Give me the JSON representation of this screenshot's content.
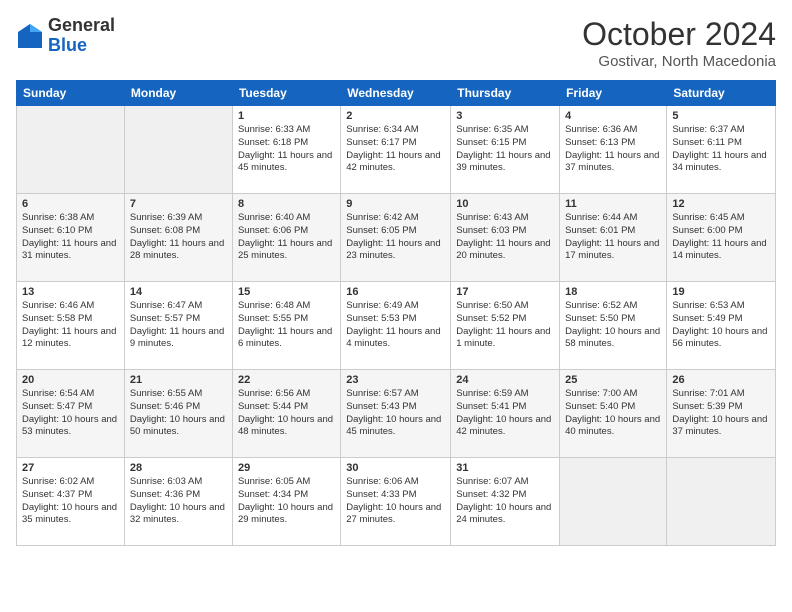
{
  "logo": {
    "general": "General",
    "blue": "Blue"
  },
  "header": {
    "month": "October 2024",
    "location": "Gostivar, North Macedonia"
  },
  "days_of_week": [
    "Sunday",
    "Monday",
    "Tuesday",
    "Wednesday",
    "Thursday",
    "Friday",
    "Saturday"
  ],
  "weeks": [
    [
      {
        "day": "",
        "sunrise": "",
        "sunset": "",
        "daylight": ""
      },
      {
        "day": "",
        "sunrise": "",
        "sunset": "",
        "daylight": ""
      },
      {
        "day": "1",
        "sunrise": "Sunrise: 6:33 AM",
        "sunset": "Sunset: 6:18 PM",
        "daylight": "Daylight: 11 hours and 45 minutes."
      },
      {
        "day": "2",
        "sunrise": "Sunrise: 6:34 AM",
        "sunset": "Sunset: 6:17 PM",
        "daylight": "Daylight: 11 hours and 42 minutes."
      },
      {
        "day": "3",
        "sunrise": "Sunrise: 6:35 AM",
        "sunset": "Sunset: 6:15 PM",
        "daylight": "Daylight: 11 hours and 39 minutes."
      },
      {
        "day": "4",
        "sunrise": "Sunrise: 6:36 AM",
        "sunset": "Sunset: 6:13 PM",
        "daylight": "Daylight: 11 hours and 37 minutes."
      },
      {
        "day": "5",
        "sunrise": "Sunrise: 6:37 AM",
        "sunset": "Sunset: 6:11 PM",
        "daylight": "Daylight: 11 hours and 34 minutes."
      }
    ],
    [
      {
        "day": "6",
        "sunrise": "Sunrise: 6:38 AM",
        "sunset": "Sunset: 6:10 PM",
        "daylight": "Daylight: 11 hours and 31 minutes."
      },
      {
        "day": "7",
        "sunrise": "Sunrise: 6:39 AM",
        "sunset": "Sunset: 6:08 PM",
        "daylight": "Daylight: 11 hours and 28 minutes."
      },
      {
        "day": "8",
        "sunrise": "Sunrise: 6:40 AM",
        "sunset": "Sunset: 6:06 PM",
        "daylight": "Daylight: 11 hours and 25 minutes."
      },
      {
        "day": "9",
        "sunrise": "Sunrise: 6:42 AM",
        "sunset": "Sunset: 6:05 PM",
        "daylight": "Daylight: 11 hours and 23 minutes."
      },
      {
        "day": "10",
        "sunrise": "Sunrise: 6:43 AM",
        "sunset": "Sunset: 6:03 PM",
        "daylight": "Daylight: 11 hours and 20 minutes."
      },
      {
        "day": "11",
        "sunrise": "Sunrise: 6:44 AM",
        "sunset": "Sunset: 6:01 PM",
        "daylight": "Daylight: 11 hours and 17 minutes."
      },
      {
        "day": "12",
        "sunrise": "Sunrise: 6:45 AM",
        "sunset": "Sunset: 6:00 PM",
        "daylight": "Daylight: 11 hours and 14 minutes."
      }
    ],
    [
      {
        "day": "13",
        "sunrise": "Sunrise: 6:46 AM",
        "sunset": "Sunset: 5:58 PM",
        "daylight": "Daylight: 11 hours and 12 minutes."
      },
      {
        "day": "14",
        "sunrise": "Sunrise: 6:47 AM",
        "sunset": "Sunset: 5:57 PM",
        "daylight": "Daylight: 11 hours and 9 minutes."
      },
      {
        "day": "15",
        "sunrise": "Sunrise: 6:48 AM",
        "sunset": "Sunset: 5:55 PM",
        "daylight": "Daylight: 11 hours and 6 minutes."
      },
      {
        "day": "16",
        "sunrise": "Sunrise: 6:49 AM",
        "sunset": "Sunset: 5:53 PM",
        "daylight": "Daylight: 11 hours and 4 minutes."
      },
      {
        "day": "17",
        "sunrise": "Sunrise: 6:50 AM",
        "sunset": "Sunset: 5:52 PM",
        "daylight": "Daylight: 11 hours and 1 minute."
      },
      {
        "day": "18",
        "sunrise": "Sunrise: 6:52 AM",
        "sunset": "Sunset: 5:50 PM",
        "daylight": "Daylight: 10 hours and 58 minutes."
      },
      {
        "day": "19",
        "sunrise": "Sunrise: 6:53 AM",
        "sunset": "Sunset: 5:49 PM",
        "daylight": "Daylight: 10 hours and 56 minutes."
      }
    ],
    [
      {
        "day": "20",
        "sunrise": "Sunrise: 6:54 AM",
        "sunset": "Sunset: 5:47 PM",
        "daylight": "Daylight: 10 hours and 53 minutes."
      },
      {
        "day": "21",
        "sunrise": "Sunrise: 6:55 AM",
        "sunset": "Sunset: 5:46 PM",
        "daylight": "Daylight: 10 hours and 50 minutes."
      },
      {
        "day": "22",
        "sunrise": "Sunrise: 6:56 AM",
        "sunset": "Sunset: 5:44 PM",
        "daylight": "Daylight: 10 hours and 48 minutes."
      },
      {
        "day": "23",
        "sunrise": "Sunrise: 6:57 AM",
        "sunset": "Sunset: 5:43 PM",
        "daylight": "Daylight: 10 hours and 45 minutes."
      },
      {
        "day": "24",
        "sunrise": "Sunrise: 6:59 AM",
        "sunset": "Sunset: 5:41 PM",
        "daylight": "Daylight: 10 hours and 42 minutes."
      },
      {
        "day": "25",
        "sunrise": "Sunrise: 7:00 AM",
        "sunset": "Sunset: 5:40 PM",
        "daylight": "Daylight: 10 hours and 40 minutes."
      },
      {
        "day": "26",
        "sunrise": "Sunrise: 7:01 AM",
        "sunset": "Sunset: 5:39 PM",
        "daylight": "Daylight: 10 hours and 37 minutes."
      }
    ],
    [
      {
        "day": "27",
        "sunrise": "Sunrise: 6:02 AM",
        "sunset": "Sunset: 4:37 PM",
        "daylight": "Daylight: 10 hours and 35 minutes."
      },
      {
        "day": "28",
        "sunrise": "Sunrise: 6:03 AM",
        "sunset": "Sunset: 4:36 PM",
        "daylight": "Daylight: 10 hours and 32 minutes."
      },
      {
        "day": "29",
        "sunrise": "Sunrise: 6:05 AM",
        "sunset": "Sunset: 4:34 PM",
        "daylight": "Daylight: 10 hours and 29 minutes."
      },
      {
        "day": "30",
        "sunrise": "Sunrise: 6:06 AM",
        "sunset": "Sunset: 4:33 PM",
        "daylight": "Daylight: 10 hours and 27 minutes."
      },
      {
        "day": "31",
        "sunrise": "Sunrise: 6:07 AM",
        "sunset": "Sunset: 4:32 PM",
        "daylight": "Daylight: 10 hours and 24 minutes."
      },
      {
        "day": "",
        "sunrise": "",
        "sunset": "",
        "daylight": ""
      },
      {
        "day": "",
        "sunrise": "",
        "sunset": "",
        "daylight": ""
      }
    ]
  ]
}
